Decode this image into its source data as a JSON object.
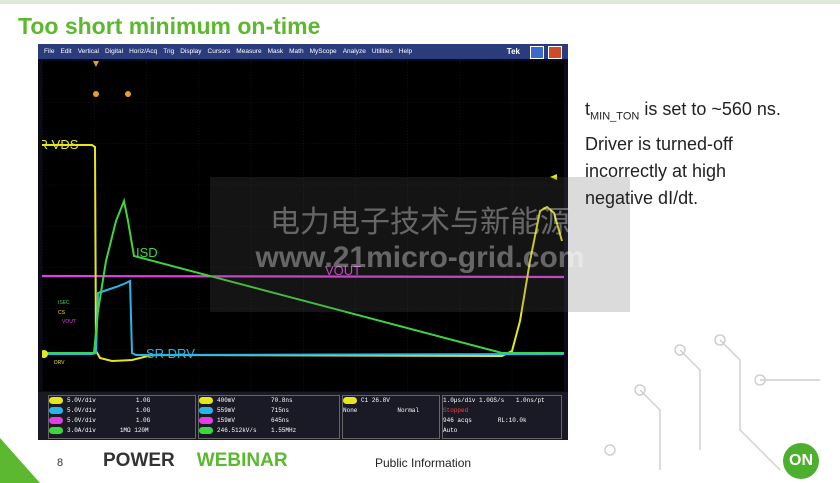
{
  "slide": {
    "title": "Too short minimum on-time",
    "description_lines": [
      "is set to ~560 ns.",
      "Driver is turned-off",
      "incorrectly at high",
      "negative dI/dt."
    ],
    "description_prefix_main": "t",
    "description_prefix_sub": "MIN_TON",
    "page_number": "8",
    "logo_power": "POWER",
    "logo_webinar": "WEBINAR",
    "public_label": "Public Information",
    "on_logo": "ON",
    "colors": {
      "title_green": "#5cb82e",
      "on_green": "#4caf2e"
    }
  },
  "scope": {
    "menu": [
      "File",
      "Edit",
      "Vertical",
      "Digital",
      "Horiz/Acq",
      "Trig",
      "Display",
      "Cursors",
      "Measure",
      "Mask",
      "Math",
      "MyScope",
      "Analyze",
      "Utilities",
      "Help"
    ],
    "brand": "Tek",
    "trace_labels": {
      "sr_vds": "SR VDS",
      "isd": "ISD",
      "vout": "VOUT",
      "sr_drv": "SR DRV",
      "isec": "ISEC",
      "cs": "CS",
      "vout_small": "VOUT",
      "drv": "DRV"
    },
    "channels": [
      {
        "label": "C1",
        "value": "5.0V/div",
        "bw": "1.0G",
        "color": "#e6e61e"
      },
      {
        "label": "C2",
        "value": "5.0V/div",
        "bw": "1.0G",
        "color": "#29b6e6"
      },
      {
        "label": "C3",
        "value": "5.0V/div",
        "bw": "1.0G",
        "color": "#e040e0"
      },
      {
        "label": "C4",
        "value": "3.0A/div",
        "bw": "120M",
        "extra": "1MΩ",
        "color": "#3ed63e"
      }
    ],
    "measurements_left": [
      "400mV",
      "559mV",
      "159mV",
      "246.512kV/s"
    ],
    "measurements_right": [
      "70.8ns",
      "715ns",
      "645ns",
      "1.55MHz"
    ],
    "trigger": {
      "channel": "C1",
      "level": "26.8V",
      "mode1": "None",
      "mode2": "Normal"
    },
    "timebase": {
      "tdiv": "1.0µs/div",
      "rate": "1.0GS/s",
      "pt": "1.0ns/pt",
      "state": "Stopped",
      "acqs": "946 acqs",
      "rl": "RL:10.0k",
      "auto": "Auto"
    }
  },
  "watermark": {
    "line1": "电力电子技术与新能源",
    "line2": "www.21micro-grid.com"
  }
}
